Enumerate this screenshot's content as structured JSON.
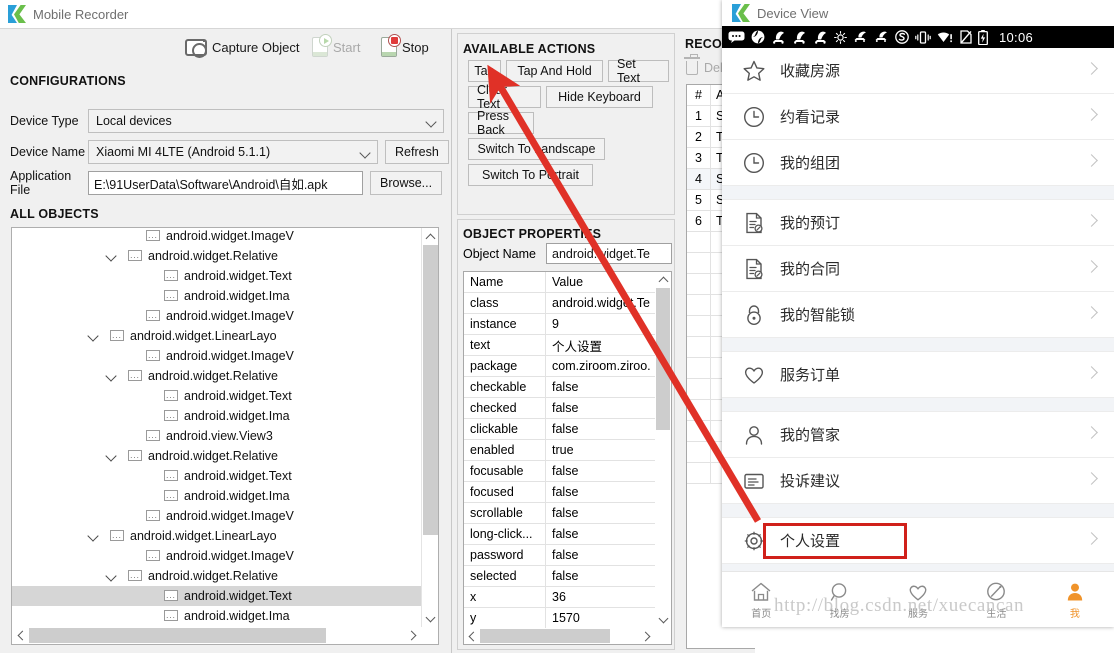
{
  "recorder": {
    "title": "Mobile Recorder",
    "toolbar": {
      "capture_label": "Capture Object",
      "start_label": "Start",
      "stop_label": "Stop",
      "capture_icon": "camera-icon",
      "start_icon": "device-play-icon",
      "stop_icon": "device-record-icon"
    },
    "configurations": {
      "header": "CONFIGURATIONS",
      "device_type_label": "Device Type",
      "device_type_value": "Local devices",
      "device_name_label": "Device Name",
      "device_name_value": "Xiaomi MI 4LTE (Android 5.1.1)",
      "refresh_label": "Refresh",
      "application_file_label": "Application File",
      "application_file_value": "E:\\91UserData\\Software\\Android\\自如.apk",
      "browse_label": "Browse..."
    },
    "all_objects": {
      "header": "ALL OBJECTS",
      "nodes": [
        {
          "depth": 5,
          "expand": "",
          "label": "android.widget.ImageV",
          "selected": false
        },
        {
          "depth": 4,
          "expand": "v",
          "label": "android.widget.Relative",
          "selected": false
        },
        {
          "depth": 6,
          "expand": "",
          "label": "android.widget.Text",
          "selected": false
        },
        {
          "depth": 6,
          "expand": "",
          "label": "android.widget.Ima",
          "selected": false
        },
        {
          "depth": 5,
          "expand": "",
          "label": "android.widget.ImageV",
          "selected": false
        },
        {
          "depth": 3,
          "expand": "v",
          "label": "android.widget.LinearLayo",
          "selected": false
        },
        {
          "depth": 5,
          "expand": "",
          "label": "android.widget.ImageV",
          "selected": false
        },
        {
          "depth": 4,
          "expand": "v",
          "label": "android.widget.Relative",
          "selected": false
        },
        {
          "depth": 6,
          "expand": "",
          "label": "android.widget.Text",
          "selected": false
        },
        {
          "depth": 6,
          "expand": "",
          "label": "android.widget.Ima",
          "selected": false
        },
        {
          "depth": 5,
          "expand": "",
          "label": "android.view.View3",
          "selected": false
        },
        {
          "depth": 4,
          "expand": "v",
          "label": "android.widget.Relative",
          "selected": false
        },
        {
          "depth": 6,
          "expand": "",
          "label": "android.widget.Text",
          "selected": false
        },
        {
          "depth": 6,
          "expand": "",
          "label": "android.widget.Ima",
          "selected": false
        },
        {
          "depth": 5,
          "expand": "",
          "label": "android.widget.ImageV",
          "selected": false
        },
        {
          "depth": 3,
          "expand": "v",
          "label": "android.widget.LinearLayo",
          "selected": false
        },
        {
          "depth": 5,
          "expand": "",
          "label": "android.widget.ImageV",
          "selected": false
        },
        {
          "depth": 4,
          "expand": "v",
          "label": "android.widget.Relative",
          "selected": false
        },
        {
          "depth": 6,
          "expand": "",
          "label": "android.widget.Text",
          "selected": true
        },
        {
          "depth": 6,
          "expand": "",
          "label": "android.widget.Ima",
          "selected": false
        }
      ]
    },
    "available_actions": {
      "header": "AVAILABLE ACTIONS",
      "buttons": [
        "Tap",
        "Tap And Hold",
        "Set Text",
        "Clear Text",
        "Hide Keyboard",
        "Press Back",
        "Switch To Landscape",
        "Switch To Portrait"
      ]
    },
    "object_properties": {
      "header": "OBJECT PROPERTIES",
      "object_name_label": "Object Name",
      "object_name_value": "android.widget.Te",
      "columns": [
        "Name",
        "Value"
      ],
      "rows": [
        {
          "name": "class",
          "value": "android.widget.Te"
        },
        {
          "name": "instance",
          "value": "9"
        },
        {
          "name": "text",
          "value": "个人设置"
        },
        {
          "name": "package",
          "value": "com.ziroom.ziroo."
        },
        {
          "name": "checkable",
          "value": "false"
        },
        {
          "name": "checked",
          "value": "false"
        },
        {
          "name": "clickable",
          "value": "false"
        },
        {
          "name": "enabled",
          "value": "true"
        },
        {
          "name": "focusable",
          "value": "false"
        },
        {
          "name": "focused",
          "value": "false"
        },
        {
          "name": "scrollable",
          "value": "false"
        },
        {
          "name": "long-click...",
          "value": "false"
        },
        {
          "name": "password",
          "value": "false"
        },
        {
          "name": "selected",
          "value": "false"
        },
        {
          "name": "x",
          "value": "36"
        },
        {
          "name": "y",
          "value": "1570"
        }
      ]
    },
    "recorded_actions": {
      "header": "RECORDED",
      "delete_label": "Delete",
      "delete_icon": "trash-icon",
      "columns": [
        "#",
        "Action"
      ],
      "rows": [
        {
          "num": "1",
          "action": "Start "
        },
        {
          "num": "2",
          "action": "Tap [t"
        },
        {
          "num": "3",
          "action": "Tap [t"
        },
        {
          "num": "4",
          "action": "Set Te"
        },
        {
          "num": "5",
          "action": "Set Te"
        },
        {
          "num": "6",
          "action": "Tap [t"
        }
      ]
    }
  },
  "device_view": {
    "title": "Device View",
    "status_bar": {
      "clock": "10:06",
      "icons": [
        "message-icon",
        "sync-icon",
        "download-icon",
        "download-icon",
        "download-icon",
        "brightness-icon",
        "mute-icon",
        "mute-icon",
        "s-circle-icon",
        "vibrate-icon",
        "wifi-alert-icon",
        "no-sim-icon",
        "battery-charging-icon"
      ]
    },
    "menu": [
      {
        "label": "收藏房源",
        "icon": "star-icon",
        "gap_after": false,
        "highlighted": false
      },
      {
        "label": "约看记录",
        "icon": "clock-icon",
        "gap_after": false,
        "highlighted": false
      },
      {
        "label": "我的组团",
        "icon": "clock-icon",
        "gap_after": true,
        "highlighted": false
      },
      {
        "label": "我的预订",
        "icon": "document-icon",
        "gap_after": false,
        "highlighted": false
      },
      {
        "label": "我的合同",
        "icon": "document-icon",
        "gap_after": false,
        "highlighted": false
      },
      {
        "label": "我的智能锁",
        "icon": "lock-icon",
        "gap_after": true,
        "highlighted": false
      },
      {
        "label": "服务订单",
        "icon": "heart-icon",
        "gap_after": true,
        "highlighted": false
      },
      {
        "label": "我的管家",
        "icon": "person-icon",
        "gap_after": false,
        "highlighted": false
      },
      {
        "label": "投诉建议",
        "icon": "note-icon",
        "gap_after": true,
        "highlighted": false
      },
      {
        "label": "个人设置",
        "icon": "gear-icon",
        "gap_after": true,
        "highlighted": true
      }
    ],
    "tabbar": [
      {
        "label": "首页",
        "icon": "home-icon",
        "active": false
      },
      {
        "label": "找房",
        "icon": "search-icon",
        "active": false
      },
      {
        "label": "服务",
        "icon": "heart-icon",
        "active": false
      },
      {
        "label": "生活",
        "icon": "compass-icon",
        "active": false
      },
      {
        "label": "我",
        "icon": "person-icon",
        "active": true
      }
    ],
    "watermark": "http://blog.csdn.net/xuecancan",
    "highlight_color": "#d0201a"
  },
  "annotation": {
    "arrow_color": "#e03127",
    "arrow_from_name": "personal-settings-row",
    "arrow_to_name": "tap-action-button"
  }
}
